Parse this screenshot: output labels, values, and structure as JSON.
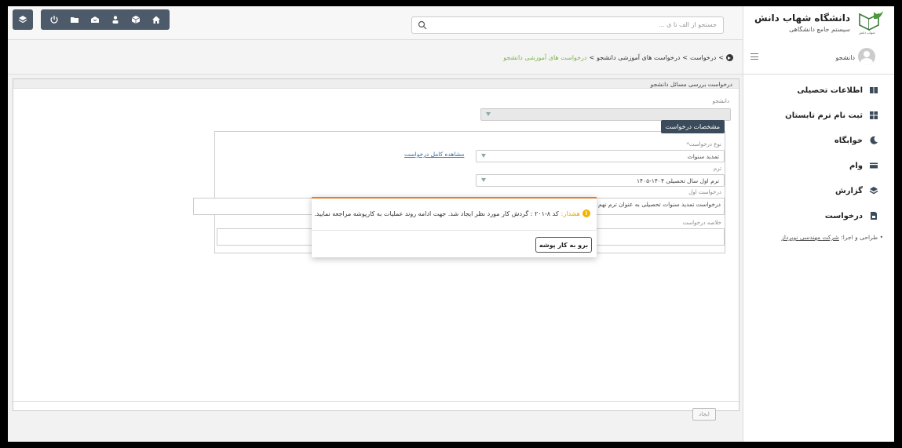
{
  "brand": {
    "title": "دانشگاه شهاب دانش",
    "subtitle": "سیستم جامع دانشگاهی"
  },
  "search": {
    "placeholder": "جستجو از الف تا ی ..."
  },
  "toolbar": {
    "icons": [
      "layers-icon",
      "power-icon",
      "folder-icon",
      "inbox-icon",
      "user-icon",
      "cube-icon",
      "home-icon"
    ]
  },
  "breadcrumb": {
    "items": [
      "درخواست",
      "درخواست های آموزشی دانشجو"
    ],
    "active": "درخواست های آموزشی دانشجو"
  },
  "user": {
    "name": "دانشجو"
  },
  "menu": [
    {
      "label": "اطلاعات تحصیلی",
      "icon": "book-icon"
    },
    {
      "label": "ثبت نام ترم تابستان",
      "icon": "grid-icon"
    },
    {
      "label": "خوابگاه",
      "icon": "moon-icon"
    },
    {
      "label": "وام",
      "icon": "card-icon"
    },
    {
      "label": "گزارش",
      "icon": "layers-icon"
    },
    {
      "label": "درخواست",
      "icon": "document-icon"
    }
  ],
  "credit": {
    "prefix": "طراحی و اجرا:",
    "company": "شرکت مهندسی نوپرداز"
  },
  "form": {
    "panel_title": "درخواست بررسی مسائل دانشجو",
    "student_label": "دانشجو",
    "legend": "مشخصات درخواست",
    "type_label": "نوع درخواست*",
    "type_value": "تمدید سنوات",
    "view_link": "مشاهده کامل درخواست",
    "term_label": "ترم",
    "term_value": "ترم اول سال تحصیلی ۱۴۰۴-۱۴۰۵",
    "first_request_label": "درخواست اول",
    "first_request_value": "درخواست تمدید سنوات تحصیلی به عنوان ترم نهم",
    "summary_label": "خلاصه درخواست",
    "create_button": "ایجاد"
  },
  "modal": {
    "warning_label": "هشدار:",
    "message": "کد ۸-۲۰۱ : گردش کار مورد نظر ایجاد شد. جهت ادامه روند عملیات به کارپوشه مراجعه نمایید.",
    "button": "برو به کار پوشه"
  },
  "colors": {
    "accent": "#7ab648",
    "warning": "#e67e22",
    "toolbar": "#4d5a6a",
    "link": "#3a6ea5"
  }
}
